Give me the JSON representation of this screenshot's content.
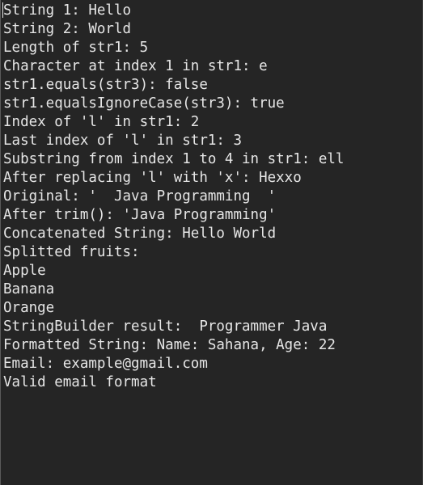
{
  "console": {
    "lines": [
      "String 1: Hello",
      "String 2: World",
      "Length of str1: 5",
      "Character at index 1 in str1: e",
      "str1.equals(str3): false",
      "str1.equalsIgnoreCase(str3): true",
      "Index of 'l' in str1: 2",
      "Last index of 'l' in str1: 3",
      "Substring from index 1 to 4 in str1: ell",
      "After replacing 'l' with 'x': Hexxo",
      "Original: '  Java Programming  '",
      "After trim(): 'Java Programming'",
      "Concatenated String: Hello World",
      "Splitted fruits:",
      "Apple",
      "Banana",
      "Orange",
      "StringBuilder result:  Programmer Java",
      "Formatted String: Name: Sahana, Age: 22",
      "Email: example@gmail.com",
      "Valid email format"
    ]
  }
}
